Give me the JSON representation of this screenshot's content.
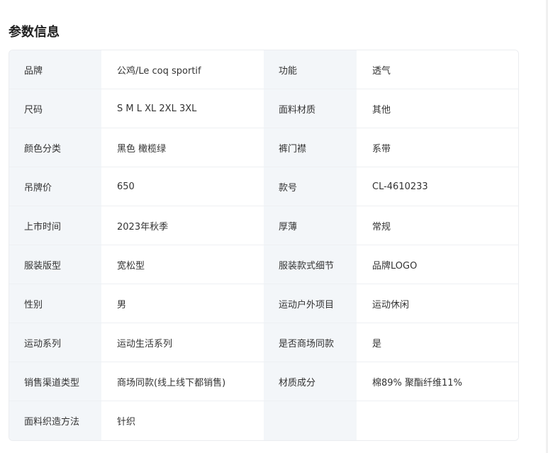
{
  "section_title": "参数信息",
  "params": [
    {
      "left_label": "品牌",
      "left_value": "公鸡/Le coq sportif",
      "right_label": "功能",
      "right_value": "透气"
    },
    {
      "left_label": "尺码",
      "left_value": "S M L XL 2XL 3XL",
      "right_label": "面料材质",
      "right_value": "其他"
    },
    {
      "left_label": "颜色分类",
      "left_value": "黑色 橄榄绿",
      "right_label": "裤门襟",
      "right_value": "系带"
    },
    {
      "left_label": "吊牌价",
      "left_value": "650",
      "right_label": "款号",
      "right_value": "CL-4610233"
    },
    {
      "left_label": "上市时间",
      "left_value": "2023年秋季",
      "right_label": "厚薄",
      "right_value": "常规"
    },
    {
      "left_label": "服装版型",
      "left_value": "宽松型",
      "right_label": "服装款式细节",
      "right_value": "品牌LOGO"
    },
    {
      "left_label": "性别",
      "left_value": "男",
      "right_label": "运动户外项目",
      "right_value": "运动休闲"
    },
    {
      "left_label": "运动系列",
      "left_value": "运动生活系列",
      "right_label": "是否商场同款",
      "right_value": "是"
    },
    {
      "left_label": "销售渠道类型",
      "left_value": "商场同款(线上线下都销售)",
      "right_label": "材质成分",
      "right_value": "棉89% 聚酯纤维11%"
    },
    {
      "left_label": "面料织造方法",
      "left_value": "针织",
      "right_label": "",
      "right_value": ""
    }
  ]
}
